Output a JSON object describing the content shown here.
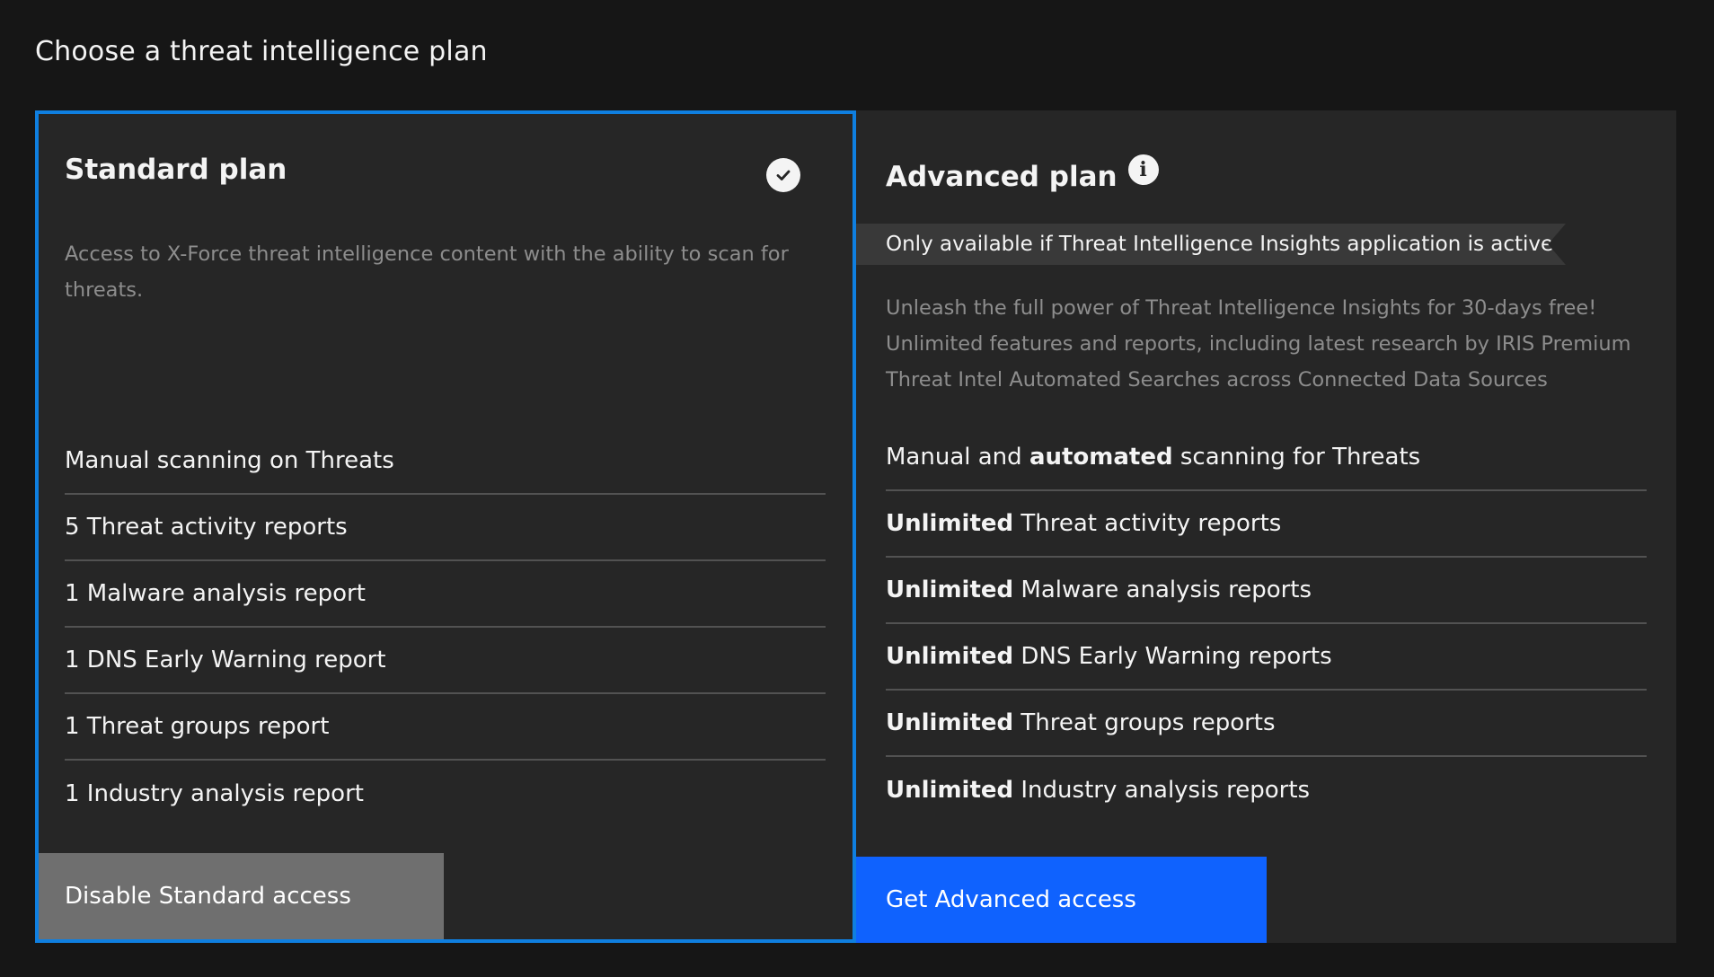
{
  "page": {
    "title": "Choose a threat intelligence plan"
  },
  "standard": {
    "title": "Standard plan",
    "selected_icon": "checkmark-filled-icon",
    "description": "Access to X-Force threat intelligence content with the ability to scan for threats.",
    "features": [
      {
        "bold": "",
        "text": "Manual scanning on Threats"
      },
      {
        "bold": "",
        "text": "5 Threat activity reports"
      },
      {
        "bold": "",
        "text": "1 Malware analysis report"
      },
      {
        "bold": "",
        "text": "1 DNS Early Warning report"
      },
      {
        "bold": "",
        "text": "1 Threat groups report"
      },
      {
        "bold": "",
        "text": "1 Industry analysis report"
      }
    ],
    "button_label": "Disable Standard access"
  },
  "advanced": {
    "title": "Advanced plan",
    "info_icon": "information-icon",
    "notice": "Only available if Threat Intelligence Insights application is active",
    "description_lines": [
      "Unleash the full power of Threat Intelligence Insights for 30-days free!",
      "Unlimited features and reports, including latest research by IRIS Premium",
      "Threat Intel Automated Searches across Connected Data Sources"
    ],
    "features": [
      {
        "pre": "Manual and ",
        "bold": "automated",
        "post": " scanning for Threats"
      },
      {
        "pre": "",
        "bold": "Unlimited",
        "post": " Threat activity reports"
      },
      {
        "pre": "",
        "bold": "Unlimited",
        "post": " Malware analysis reports"
      },
      {
        "pre": "",
        "bold": "Unlimited",
        "post": " DNS Early Warning reports"
      },
      {
        "pre": "",
        "bold": "Unlimited",
        "post": " Threat groups reports"
      },
      {
        "pre": "",
        "bold": "Unlimited",
        "post": " Industry analysis reports"
      }
    ],
    "button_label": "Get Advanced access"
  },
  "colors": {
    "background": "#161616",
    "card": "#262626",
    "selected_border": "#0f7fe0",
    "primary_button": "#0f62fe",
    "secondary_button": "#6f6f6f"
  }
}
